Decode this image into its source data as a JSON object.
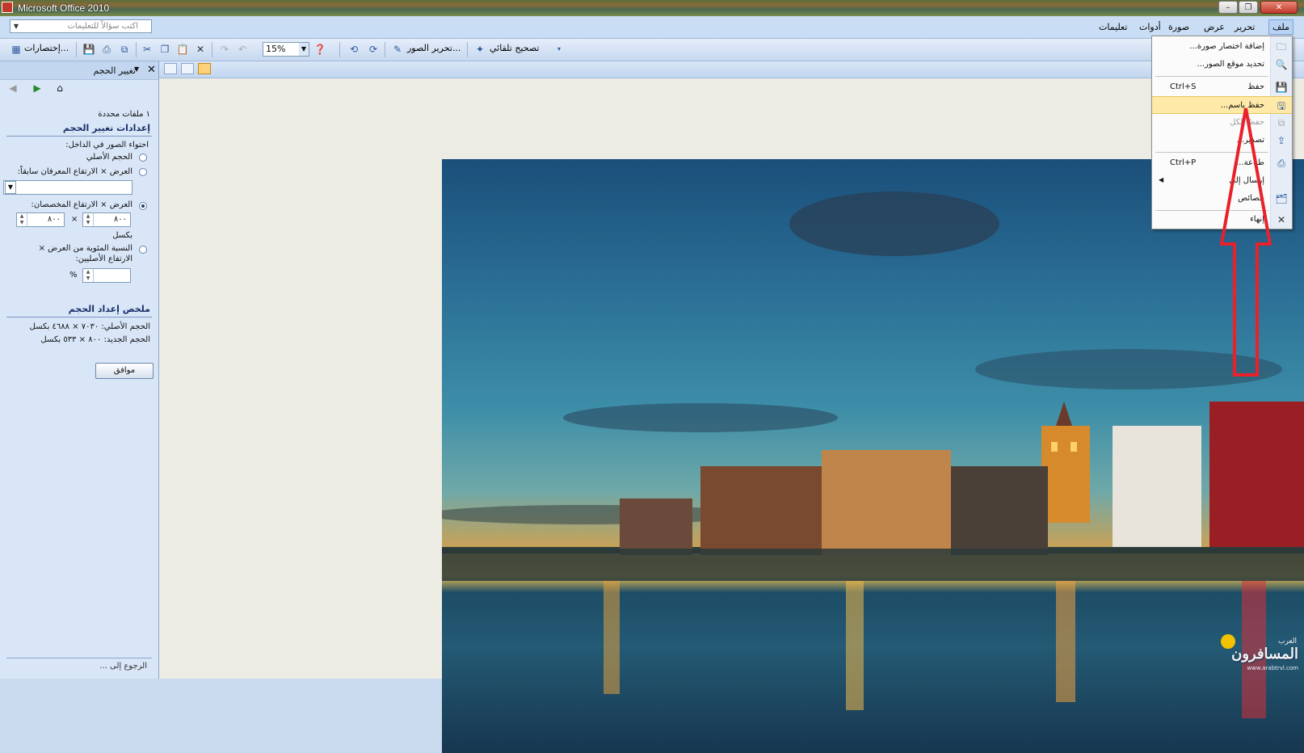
{
  "window": {
    "title": "Microsoft Office 2010",
    "controls": [
      "minimize",
      "maximize",
      "close"
    ]
  },
  "menubar": {
    "ask_placeholder": "اكتب سؤالاً للتعليمات",
    "items": [
      "ملف",
      "تحرير",
      "عرض",
      "صورة",
      "أدوات",
      "تعليمات"
    ]
  },
  "toolbar": {
    "shortcuts_label": "إختصارات...",
    "zoom_value": "15%",
    "edit_pictures_label": "تحرير الصور...",
    "autocorrect_label": "تصحيح تلقائي"
  },
  "taskpane": {
    "title": "تغيير الحجم",
    "files_selected": "١ ملفات محددة",
    "settings_header": "إعدادات تغيير الحجم",
    "contain_label": "احتواء الصور في الداخل:",
    "original_size": "الحجم الأصلي",
    "predefined_label": "العرض × الارتفاع المعرفان سابقاً:",
    "custom_label": "العرض × الارتفاع المخصصان:",
    "width_value": "٨٠٠",
    "height_value": "٨٠٠",
    "times_sign": "×",
    "pixels_label": "بكسل",
    "percent_label_line1": "النسبة المئوية من العرض ×",
    "percent_label_line2": "الارتفاع الأصليين:",
    "percent_sign": "%",
    "summary_header": "ملخص إعداد الحجم",
    "original_size_summary": "الحجم الأصلي: ٧٠٣٠ × ٤٦٨٨ بكسل",
    "new_size_summary": "الحجم الجديد: ٨٠٠ × ٥٣٣ بكسل",
    "ok_label": "موافق",
    "bottom_link": "الرجوع إلى ..."
  },
  "file_menu": {
    "items": [
      {
        "label": "إضافة اختصار صورة...",
        "shortcut": "",
        "icon": "folder-add-icon",
        "disabled": false
      },
      {
        "label": "تحديد موقع الصور...",
        "shortcut": "",
        "icon": "locate-pictures-icon",
        "disabled": false
      },
      {
        "label": "حفظ",
        "shortcut": "Ctrl+S",
        "icon": "save-icon",
        "disabled": false
      },
      {
        "label": "حفظ باسم...",
        "shortcut": "",
        "icon": "save-as-icon",
        "disabled": false,
        "highlighted": true
      },
      {
        "label": "حفظ الكل",
        "shortcut": "",
        "icon": "save-all-icon",
        "disabled": true
      },
      {
        "label": "تصدير...",
        "shortcut": "",
        "icon": "export-icon",
        "disabled": false
      },
      {
        "label": "طباعة...",
        "shortcut": "Ctrl+P",
        "icon": "print-icon",
        "disabled": false
      },
      {
        "label": "إرسال إلى",
        "shortcut": "",
        "icon": "",
        "disabled": false,
        "submenu": true
      },
      {
        "label": "خصائص",
        "shortcut": "",
        "icon": "properties-icon",
        "disabled": false
      },
      {
        "label": "إنهاء",
        "shortcut": "",
        "icon": "exit-icon",
        "disabled": false
      }
    ]
  },
  "watermark": {
    "text": "المسافرون",
    "small_text": "العرب",
    "url": "www.arabtrvl.com"
  },
  "colors": {
    "menubar_bg": "#c9ddf4",
    "pane_bg": "#d8e6f8",
    "highlight": "#ffe9a8",
    "arrow": "#e8212b"
  }
}
